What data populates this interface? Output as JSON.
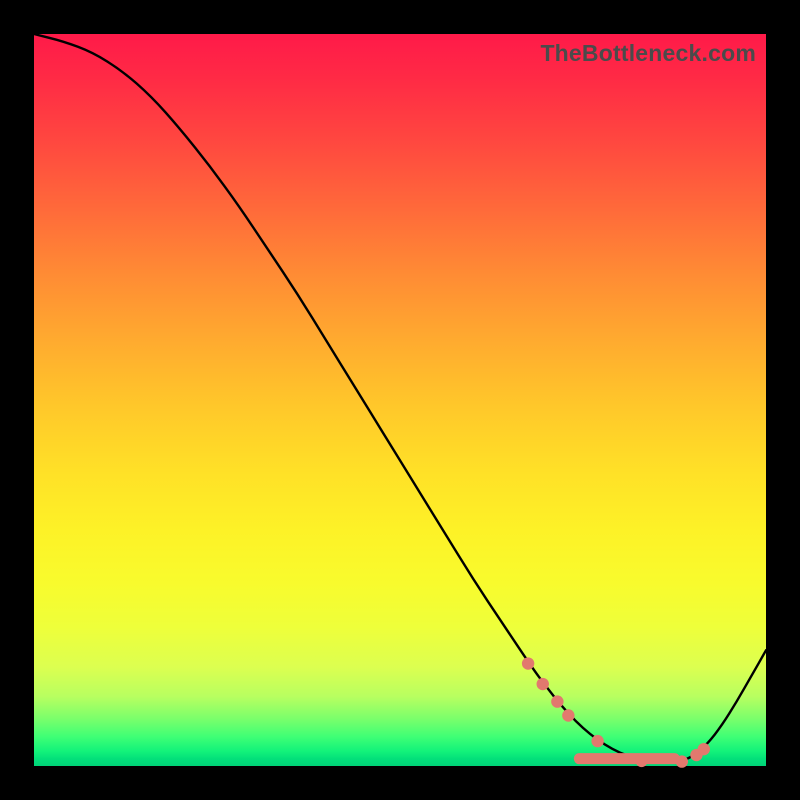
{
  "watermark": "TheBottleneck.com",
  "chart_data": {
    "type": "line",
    "title": "",
    "xlabel": "",
    "ylabel": "",
    "xlim": [
      0,
      100
    ],
    "ylim": [
      0,
      100
    ],
    "grid": false,
    "legend": false,
    "series": [
      {
        "name": "bottleneck-curve",
        "x": [
          0,
          4,
          8,
          12,
          16,
          20,
          24,
          28,
          32,
          36,
          40,
          44,
          48,
          52,
          56,
          60,
          64,
          68,
          70,
          72,
          74,
          76,
          78,
          80,
          82,
          84,
          86,
          88,
          90,
          92,
          94,
          96,
          98,
          100
        ],
        "y": [
          100,
          99,
          97.5,
          95,
          91.5,
          87,
          82,
          76.5,
          70.5,
          64.5,
          58,
          51.5,
          45,
          38.5,
          32,
          25.5,
          19.5,
          13.5,
          10.8,
          8.3,
          6.1,
          4.3,
          2.9,
          1.8,
          1.1,
          0.6,
          0.4,
          0.5,
          1.3,
          3.0,
          5.6,
          8.8,
          12.3,
          15.8
        ]
      }
    ],
    "markers": {
      "name": "highlight-dots",
      "color": "#e2796e",
      "points_x": [
        67.5,
        69.5,
        71.5,
        73,
        77,
        83,
        88.5,
        90.5,
        91.5
      ],
      "points_y": [
        14.0,
        11.2,
        8.8,
        6.9,
        3.4,
        0.7,
        0.6,
        1.5,
        2.3
      ],
      "bar_segment": {
        "x_start": 74.5,
        "x_end": 87.5,
        "y": 1.0
      }
    },
    "background_gradient": {
      "orientation": "vertical",
      "stops": [
        {
          "pos": 0.0,
          "color": "#ff1a49"
        },
        {
          "pos": 0.25,
          "color": "#ff7a36"
        },
        {
          "pos": 0.5,
          "color": "#ffcf29"
        },
        {
          "pos": 0.75,
          "color": "#f6fc2b"
        },
        {
          "pos": 0.93,
          "color": "#80ff6a"
        },
        {
          "pos": 1.0,
          "color": "#00d478"
        }
      ]
    }
  }
}
